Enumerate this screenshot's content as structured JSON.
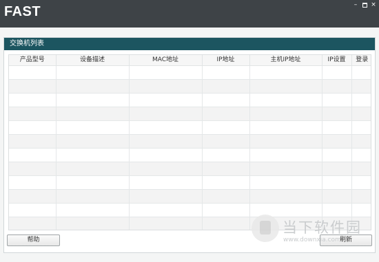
{
  "app": {
    "logo": "FAST",
    "window_buttons": {
      "minimize": "–",
      "close": "×"
    }
  },
  "panel": {
    "title": "交换机列表",
    "table": {
      "columns": [
        "产品型号",
        "设备描述",
        "MAC地址",
        "IP地址",
        "主机IP地址",
        "IP设置",
        "登录"
      ],
      "rows": []
    }
  },
  "buttons": {
    "help": "帮助",
    "refresh": "刷新"
  },
  "watermark": {
    "text": "当下软件园",
    "url": "www.downxia.com"
  },
  "colors": {
    "titlebar": "#3e4347",
    "panel_header": "#1c5560",
    "row_alt": "#f3f3f3"
  }
}
